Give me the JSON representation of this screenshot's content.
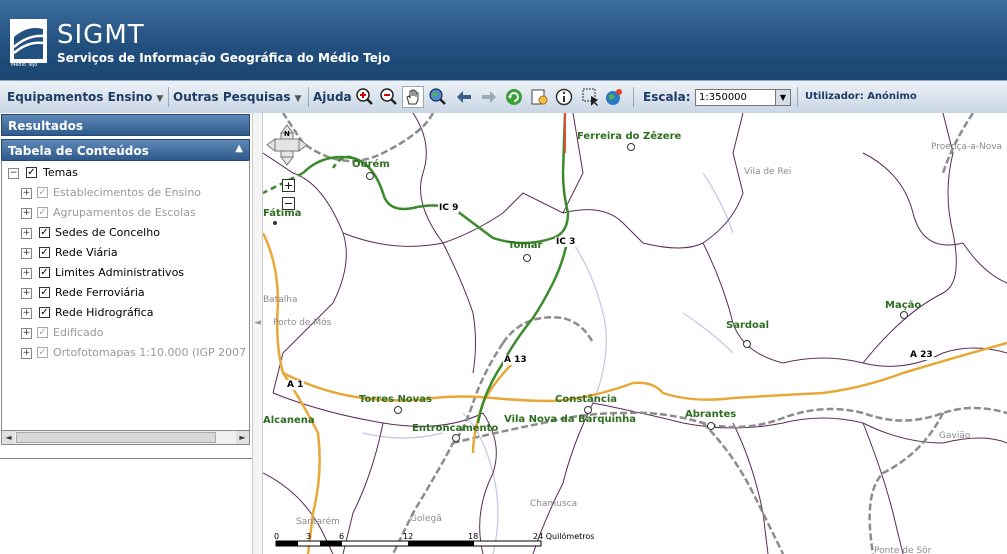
{
  "header": {
    "app_title": "SIGMT",
    "app_subtitle": "Serviços de Informação Geográfica do Médio Tejo",
    "logo_caption": "Médio Tejo"
  },
  "toolbar": {
    "menu_equipamentos": "Equipamentos Ensino",
    "menu_outras": "Outras Pesquisas",
    "menu_ajuda": "Ajuda",
    "scale_label": "Escala:",
    "scale_value": "1:350000",
    "user_label": "Utilizador: Anónimo",
    "icons": [
      "zoom-in-icon",
      "zoom-out-icon",
      "pan-hand-icon",
      "zoom-extent-icon",
      "back-arrow-icon",
      "forward-arrow-icon",
      "refresh-icon",
      "print-icon",
      "info-icon",
      "select-icon",
      "globe-icon"
    ]
  },
  "panel": {
    "results_title": "Resultados",
    "contents_title": "Tabela de Conteúdos",
    "root": "Temas",
    "layers": [
      {
        "label": "Establecimentos de Ensino",
        "enabled": false
      },
      {
        "label": "Agrupamentos de Escolas",
        "enabled": false
      },
      {
        "label": "Sedes de Concelho",
        "enabled": true
      },
      {
        "label": "Rede Viária",
        "enabled": true
      },
      {
        "label": "Limites Administrativos",
        "enabled": true
      },
      {
        "label": "Rede Ferroviária",
        "enabled": true
      },
      {
        "label": "Rede Hidrográfica",
        "enabled": true
      },
      {
        "label": "Edificado",
        "enabled": false
      },
      {
        "label": "Ortofotomapas 1:10.000 (IGP 2007",
        "enabled": false
      }
    ]
  },
  "map": {
    "places": [
      "Ferreira do Zêzere",
      "Ourém",
      "Fátima",
      "Tomar",
      "Sardoal",
      "Mação",
      "Torres Novas",
      "Constância",
      "Abrantes",
      "Alcanena",
      "Entroncamento",
      "Vila Nova da Barquinha"
    ],
    "gray_places": [
      "Proença-a-Nova",
      "Vila de Rei",
      "Batalha",
      "Porto de Mós",
      "Gavião",
      "Chamusca",
      "Golegã",
      "Santarém",
      "Ponte de Sôr"
    ],
    "road_labels": [
      "IC 9",
      "IC 3",
      "A 13",
      "A 1",
      "A 23"
    ],
    "scalebar_ticks": [
      "0",
      "3",
      "6",
      "12",
      "18",
      "24 Quilómetros"
    ],
    "colors": {
      "motorway": "#e8a838",
      "ic_road": "#3b8a2c",
      "rail": "#8c8c8c",
      "boundary": "#5a2a5a",
      "river": "#b8b8e0",
      "header": "#22507f"
    }
  }
}
